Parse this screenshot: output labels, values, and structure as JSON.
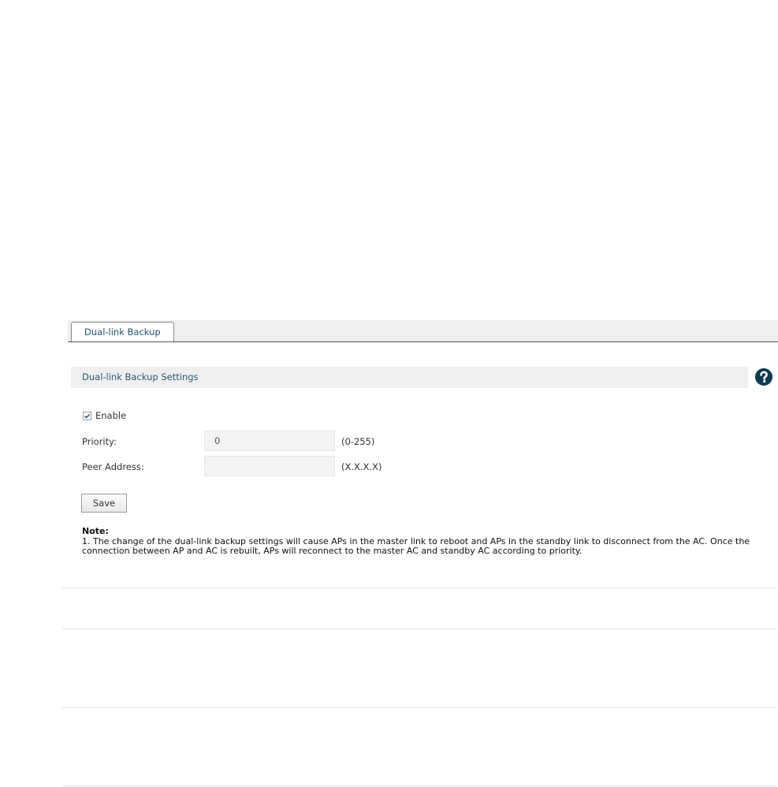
{
  "tabs": [
    {
      "label": "Dual-link Backup",
      "active": true
    }
  ],
  "section": {
    "title": "Dual-link Backup Settings",
    "help_icon": "question-circle-icon"
  },
  "form": {
    "enable": {
      "label": "Enable",
      "checked": true
    },
    "priority": {
      "label": "Priority:",
      "value": "0",
      "hint": "(0-255)"
    },
    "peer_address": {
      "label": "Peer Address:",
      "value": "",
      "hint": "(X.X.X.X)"
    }
  },
  "buttons": {
    "save_label": "Save"
  },
  "note": {
    "title": "Note:",
    "text": "1. The change of the dual-link backup settings will cause APs in the master link to reboot and APs in the standby link to disconnect from the AC. Once the connection between AP and AC is rebuilt, APs will reconnect to the master AC and standby AC according to priority."
  },
  "colors": {
    "accent_text": "#2a5670",
    "help_icon": "#0b3a4e",
    "header_bg": "#efefef"
  }
}
